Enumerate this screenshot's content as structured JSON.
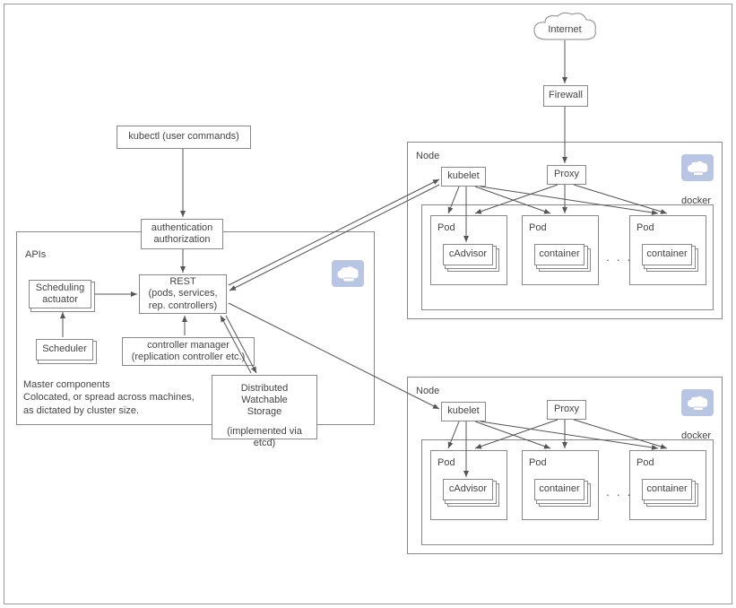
{
  "internet": "Internet",
  "firewall": "Firewall",
  "kubectl": "kubectl (user commands)",
  "apis_label": "APIs",
  "auth": {
    "line1": "authentication",
    "line2": "authorization"
  },
  "rest": {
    "title": "REST",
    "subtitle1": "(pods, services,",
    "subtitle2": "rep. controllers)"
  },
  "scheduling_actuator": {
    "line1": "Scheduling",
    "line2": "actuator"
  },
  "scheduler": "Scheduler",
  "controller_manager": {
    "line1": "controller manager",
    "line2": "(replication controller etc.)"
  },
  "master_note": {
    "line1": "Master components",
    "line2": "Colocated, or spread across machines,",
    "line3": "as dictated by cluster size."
  },
  "storage": {
    "line1": "Distributed",
    "line2": "Watchable",
    "line3": "Storage",
    "sub": "(implemented via etcd)"
  },
  "node_label": "Node",
  "kubelet": "kubelet",
  "proxy": "Proxy",
  "docker_label": "docker",
  "pod_label": "Pod",
  "cadvisor": "cAdvisor",
  "container": "container",
  "ellipsis": ". . ."
}
